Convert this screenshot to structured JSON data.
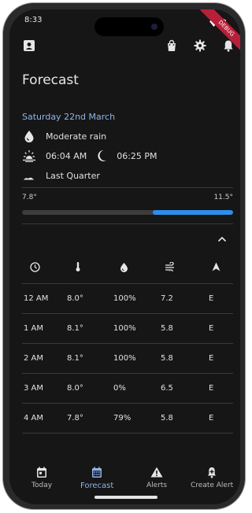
{
  "status_bar": {
    "time": "8:33",
    "debug_label": "DEBUG"
  },
  "app_bar": {
    "title": "Forecast",
    "left_icon": "contact-card-icon",
    "right_icons": [
      "shopping-bag-icon",
      "gear-icon",
      "bell-icon"
    ]
  },
  "summary": {
    "date": "Saturday 22nd March",
    "condition": "Moderate rain",
    "sunrise": "06:04 AM",
    "sunset": "06:25 PM",
    "moon_phase": "Last Quarter"
  },
  "temperature": {
    "min_label": "7.8°",
    "max_label": "11.5°",
    "range_start_fraction": 0.62,
    "range_end_fraction": 1.0
  },
  "table": {
    "header_icons": [
      "clock-icon",
      "thermometer-icon",
      "drop-icon",
      "wind-icon",
      "direction-arrow-icon"
    ],
    "rows": [
      {
        "time": "12 AM",
        "temp": "8.0°",
        "precip": "100%",
        "wind": "7.2",
        "dir": "E"
      },
      {
        "time": "1 AM",
        "temp": "8.1°",
        "precip": "100%",
        "wind": "5.8",
        "dir": "E"
      },
      {
        "time": "2 AM",
        "temp": "8.1°",
        "precip": "100%",
        "wind": "5.8",
        "dir": "E"
      },
      {
        "time": "3 AM",
        "temp": "8.0°",
        "precip": "0%",
        "wind": "6.5",
        "dir": "E"
      },
      {
        "time": "4 AM",
        "temp": "7.8°",
        "precip": "79%",
        "wind": "5.8",
        "dir": "E"
      }
    ]
  },
  "bottom_nav": {
    "items": [
      {
        "label": "Today",
        "icon": "calendar-day-icon",
        "active": false
      },
      {
        "label": "Forecast",
        "icon": "calendar-grid-icon",
        "active": true
      },
      {
        "label": "Alerts",
        "icon": "warning-icon",
        "active": false
      },
      {
        "label": "Create Alert",
        "icon": "bell-plus-icon",
        "active": false
      }
    ]
  },
  "colors": {
    "background": "#161616",
    "accent": "#8fb3ea",
    "bar_fill": "#2e8ee8",
    "debug_ribbon": "#b8203a"
  }
}
